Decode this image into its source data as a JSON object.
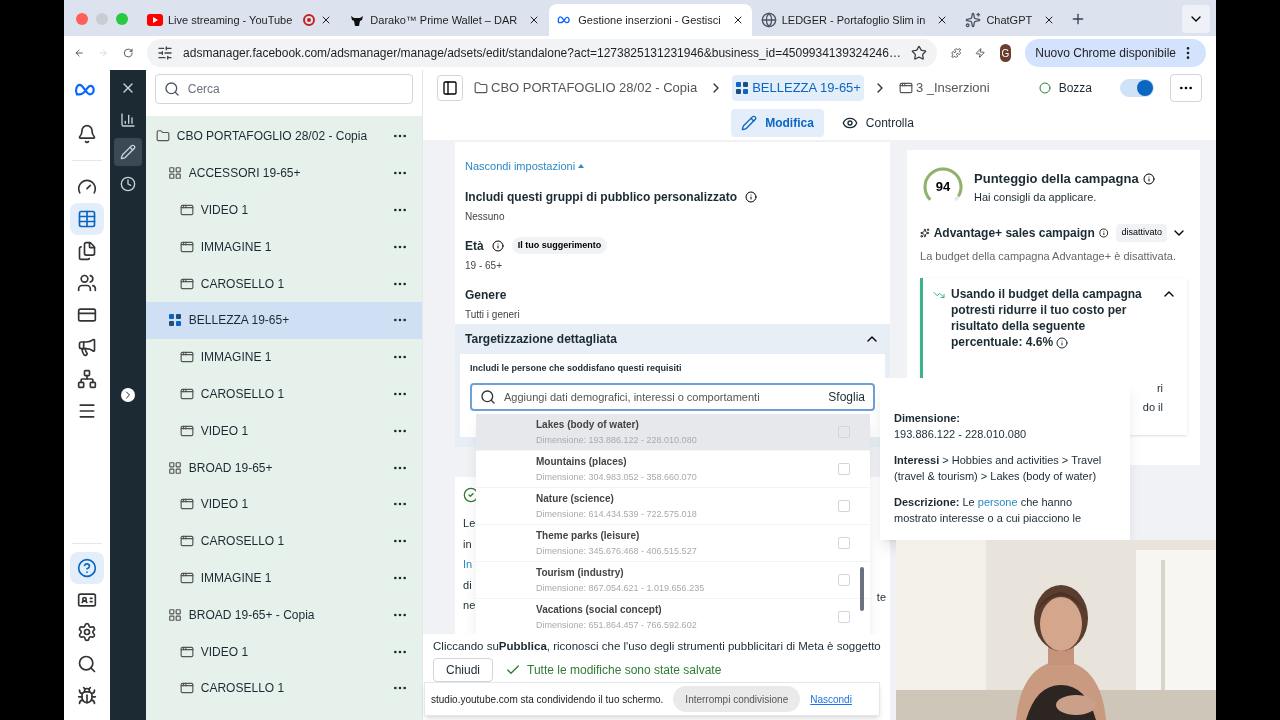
{
  "browser": {
    "tabs": [
      {
        "title": "Live streaming - YouTube",
        "selected": false,
        "recording": true
      },
      {
        "title": "Darako™ Prime Wallet – DAR",
        "selected": false,
        "recording": false
      },
      {
        "title": "Gestione inserzioni - Gestisci",
        "selected": true,
        "recording": false
      },
      {
        "title": "LEDGER - Portafoglio Slim in",
        "selected": false,
        "recording": false
      },
      {
        "title": "ChatGPT",
        "selected": false,
        "recording": false
      }
    ],
    "url": "adsmanager.facebook.com/adsmanager/manage/adsets/edit/standalone?act=1273825131231946&business_id=4509934139324246…",
    "profile_initial": "G",
    "update_button": "Nuovo Chrome disponibile"
  },
  "nav_rail": {
    "top": [
      {
        "selected": false
      },
      {
        "selected": false
      },
      {
        "selected": true
      },
      {
        "selected": false
      },
      {
        "selected": false
      },
      {
        "selected": false
      },
      {
        "selected": false
      },
      {
        "selected": false
      },
      {
        "selected": false
      }
    ],
    "bottom": [
      {
        "selected": true
      },
      {
        "selected": false
      },
      {
        "selected": false
      },
      {
        "selected": false
      },
      {
        "selected": false
      }
    ]
  },
  "tool_rail": [
    {
      "selected": false
    },
    {
      "selected": false
    },
    {
      "selected": true
    },
    {
      "selected": false
    }
  ],
  "tree": {
    "search_placeholder": "Cerca",
    "items": [
      {
        "label": "CBO PORTAFOGLIO 28/02 - Copia",
        "kind": "campaign",
        "selected": false,
        "children": [
          {
            "label": "ACCESSORI 19-65+",
            "kind": "adset",
            "selected": false,
            "children": [
              {
                "label": "VIDEO 1",
                "kind": "ad",
                "selected": false
              },
              {
                "label": "IMMAGINE 1",
                "kind": "ad",
                "selected": false
              },
              {
                "label": "CAROSELLO 1",
                "kind": "ad",
                "selected": false
              }
            ]
          },
          {
            "label": "BELLEZZA 19-65+",
            "kind": "adset",
            "selected": true,
            "children": [
              {
                "label": "IMMAGINE 1",
                "kind": "ad",
                "selected": false
              },
              {
                "label": "CAROSELLO 1",
                "kind": "ad",
                "selected": false
              },
              {
                "label": "VIDEO 1",
                "kind": "ad",
                "selected": false
              }
            ]
          },
          {
            "label": "BROAD 19-65+",
            "kind": "adset",
            "selected": false,
            "children": [
              {
                "label": "VIDEO 1",
                "kind": "ad",
                "selected": false
              },
              {
                "label": "CAROSELLO 1",
                "kind": "ad",
                "selected": false
              },
              {
                "label": "IMMAGINE 1",
                "kind": "ad",
                "selected": false
              }
            ]
          },
          {
            "label": "BROAD 19-65+ - Copia",
            "kind": "adset",
            "selected": false,
            "children": [
              {
                "label": "VIDEO 1",
                "kind": "ad",
                "selected": false
              },
              {
                "label": "CAROSELLO 1",
                "kind": "ad",
                "selected": false
              }
            ]
          }
        ]
      }
    ]
  },
  "header": {
    "breadcrumbs": [
      {
        "label": "CBO PORTAFOGLIO 28/02 - Copia",
        "kind": "campaign",
        "selected": false
      },
      {
        "label": "BELLEZZA 19-65+",
        "kind": "adset",
        "selected": true
      },
      {
        "label": "3 _Inserzioni",
        "kind": "ad",
        "selected": false
      }
    ],
    "status": "Bozza",
    "on": true
  },
  "mode_tabs": [
    {
      "label": "Modifica",
      "selected": true
    },
    {
      "label": "Controlla",
      "selected": false
    }
  ],
  "audience": {
    "hide_link": "Nascondi impostazioni",
    "custom": {
      "label": "Includi questi gruppi di pubblico personalizzato",
      "value": "Nessuno"
    },
    "age": {
      "label": "Età",
      "badge": "Il tuo suggerimento",
      "value": "19 - 65+"
    },
    "gender": {
      "label": "Genere",
      "value": "Tutti i generi"
    },
    "detailed": {
      "title": "Targetizzazione dettagliata",
      "expanded": true,
      "include_label": "Includi le persone che soddisfano questi requisiti",
      "search_placeholder": "Aggiungi dati demografici, interessi o comportamenti",
      "browse": "Sfoglia"
    }
  },
  "covered_card": {
    "lines": [
      "Le",
      "in",
      "In",
      "di",
      "ne"
    ],
    "edge": "te"
  },
  "suggestions": [
    {
      "name": "Lakes (body of water)",
      "size": "Dimensione: 193.886.122 - 228.010.080",
      "checked": false,
      "selected": true
    },
    {
      "name": "Mountains (places)",
      "size": "Dimensione: 304.983.052 - 358.660.070",
      "checked": false,
      "selected": false
    },
    {
      "name": "Nature (science)",
      "size": "Dimensione: 614.434.539 - 722.575.018",
      "checked": false,
      "selected": false
    },
    {
      "name": "Theme parks (leisure)",
      "size": "Dimensione: 345.676.468 - 406.515.527",
      "checked": false,
      "selected": false
    },
    {
      "name": "Tourism (industry)",
      "size": "Dimensione: 867.054.621 - 1.019.656.235",
      "checked": false,
      "selected": false
    },
    {
      "name": "Vacations (social concept)",
      "size": "Dimensione: 651.864.457 - 766.592.602",
      "checked": false,
      "selected": false
    }
  ],
  "footer": {
    "terms": "Cliccando su**Pubblica**, riconosci che l'uso degli strumenti pubblicitari di Meta è soggetto",
    "close": "Chiudi",
    "saved": "Tutte le modifiche sono state salvate"
  },
  "share_bar": {
    "message": "studio.youtube.com sta condividendo il tuo schermo.",
    "stop": "Interrompi condivisione",
    "hide": "Nascondi"
  },
  "campaign_score": {
    "score": "94",
    "title": "Punteggio della campagna",
    "subtitle": "Hai consigli da applicare."
  },
  "advantage": {
    "title": "Advantage+ sales campaign",
    "badge": "disattivato",
    "expanded": false,
    "description": "La budget della campagna Advantage+ è disattivata."
  },
  "recommendation": {
    "title": "Usando il budget della campagna potresti ridurre il tuo costo per risultato della seguente percentuale: 4.6%",
    "expanded": true,
    "covered_lines": [
      "ri",
      "do il"
    ]
  },
  "tooltip": {
    "size_label": "Dimensione:",
    "size": "193.886.122 - 228.010.080",
    "path_label": "Interessi",
    "path": "> Hobbies and activities > Travel (travel & tourism) > Lakes (body of water)",
    "description_label": "Descrizione:",
    "description_before": "Le",
    "description_link": "persone",
    "description_after": "che hanno mostrato interesse o a cui piacciono le"
  }
}
